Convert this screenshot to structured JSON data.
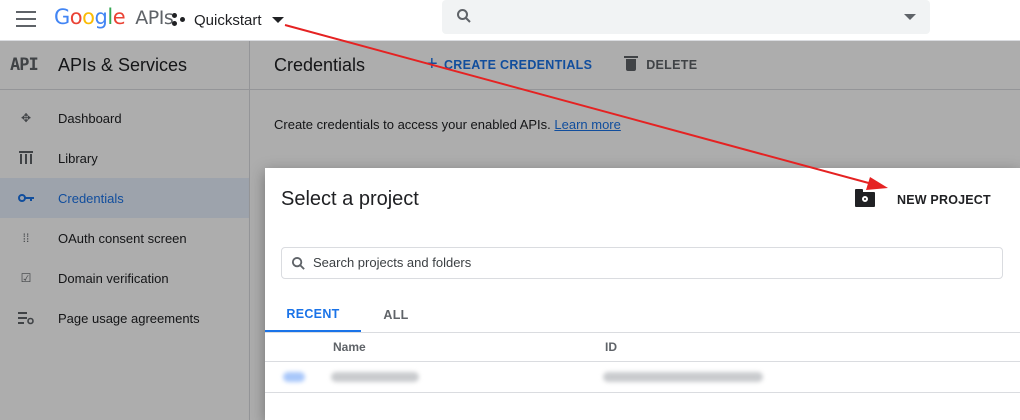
{
  "topbar": {
    "logo_google": "Google",
    "logo_apis": "APIs",
    "project_name": "Quickstart"
  },
  "sidebar": {
    "logo": "API",
    "title": "APIs & Services",
    "items": [
      {
        "label": "Dashboard",
        "icon": "dashboard-icon"
      },
      {
        "label": "Library",
        "icon": "library-icon"
      },
      {
        "label": "Credentials",
        "icon": "key-icon",
        "active": true
      },
      {
        "label": "OAuth consent screen",
        "icon": "oauth-icon"
      },
      {
        "label": "Domain verification",
        "icon": "checkbox-icon"
      },
      {
        "label": "Page usage agreements",
        "icon": "settings-list-icon"
      }
    ]
  },
  "main": {
    "title": "Credentials",
    "create_label": "CREATE CREDENTIALS",
    "delete_label": "DELETE",
    "intro_text": "Create credentials to access your enabled APIs.",
    "learn_more": "Learn more"
  },
  "dialog": {
    "title": "Select a project",
    "new_project_label": "NEW PROJECT",
    "search_placeholder": "Search projects and folders",
    "tabs": [
      "RECENT",
      "ALL"
    ],
    "active_tab": "RECENT",
    "columns": [
      "Name",
      "ID"
    ]
  },
  "colors": {
    "accent": "#1a73e8",
    "annotation_arrow": "#e52222"
  }
}
